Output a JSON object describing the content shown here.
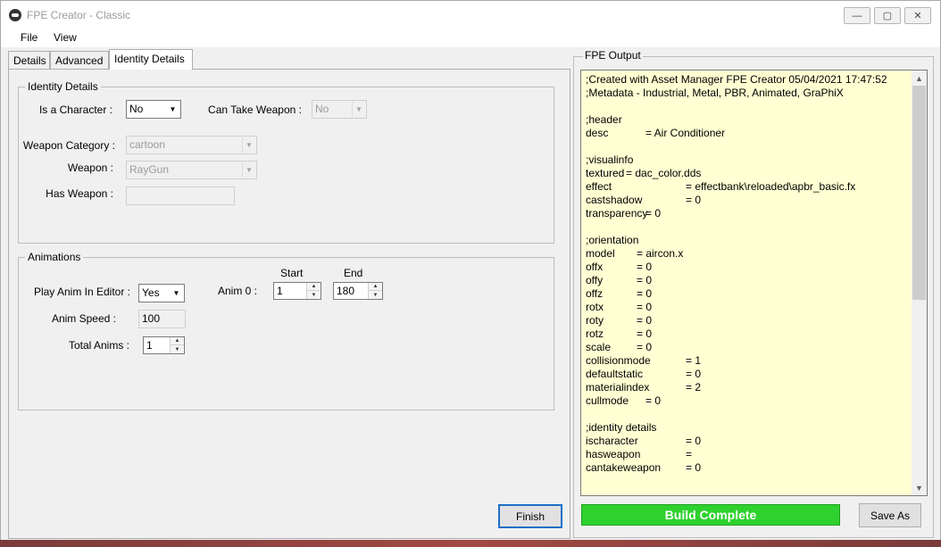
{
  "window": {
    "title": "FPE Creator - Classic",
    "minimize_glyph": "—",
    "maximize_glyph": "▢",
    "close_glyph": "✕"
  },
  "menu": {
    "file": "File",
    "view": "View"
  },
  "tabs": [
    {
      "label": "Details"
    },
    {
      "label": "Advanced"
    },
    {
      "label": "Identity Details"
    }
  ],
  "identity": {
    "group_title": "Identity Details",
    "is_character_label": "Is a Character :",
    "is_character_value": "No",
    "can_take_weapon_label": "Can Take Weapon :",
    "can_take_weapon_value": "No",
    "weapon_category_label": "Weapon Category :",
    "weapon_category_value": "cartoon",
    "weapon_label": "Weapon :",
    "weapon_value": "RayGun",
    "has_weapon_label": "Has Weapon :",
    "has_weapon_value": ""
  },
  "animations": {
    "group_title": "Animations",
    "play_anim_label": "Play Anim In Editor :",
    "play_anim_value": "Yes",
    "anim_speed_label": "Anim Speed :",
    "anim_speed_value": "100",
    "total_anims_label": "Total Anims :",
    "total_anims_value": "1",
    "anim0_label": "Anim 0 :",
    "start_header": "Start",
    "end_header": "End",
    "anim0_start": "1",
    "anim0_end": "180"
  },
  "finish_label": "Finish",
  "output": {
    "title": "FPE Output",
    "lines": [
      [
        ";Created with Asset Manager FPE Creator 05/04/2021 17:47:52",
        ""
      ],
      [
        ";Metadata - Industrial, Metal, PBR, Animated, GraPhiX",
        ""
      ],
      [
        "",
        ""
      ],
      [
        ";header",
        ""
      ],
      [
        "desc",
        "= Air Conditioner"
      ],
      [
        "",
        ""
      ],
      [
        ";visualinfo",
        ""
      ],
      [
        "textured",
        "= dac_color.dds"
      ],
      [
        "effect",
        "= effectbank\\reloaded\\apbr_basic.fx"
      ],
      [
        "castshadow",
        "= 0"
      ],
      [
        "transparency",
        "= 0"
      ],
      [
        "",
        ""
      ],
      [
        ";orientation",
        ""
      ],
      [
        "model",
        "= aircon.x"
      ],
      [
        "offx",
        "= 0"
      ],
      [
        "offy",
        "= 0"
      ],
      [
        "offz",
        "= 0"
      ],
      [
        "rotx",
        "= 0"
      ],
      [
        "roty",
        "= 0"
      ],
      [
        "rotz",
        "= 0"
      ],
      [
        "scale",
        "= 0"
      ],
      [
        "collisionmode",
        "= 1"
      ],
      [
        "defaultstatic",
        "= 0"
      ],
      [
        "materialindex",
        "= 2"
      ],
      [
        "cullmode",
        "= 0"
      ],
      [
        "",
        ""
      ],
      [
        ";identity details",
        ""
      ],
      [
        "ischaracter",
        "= 0"
      ],
      [
        "hasweapon",
        "="
      ],
      [
        "cantakeweapon",
        "= 0"
      ]
    ]
  },
  "build_status": "Build Complete",
  "save_as_label": "Save As",
  "colors": {
    "build_status_bg": "#2ed12e",
    "output_bg": "#ffffd3"
  }
}
